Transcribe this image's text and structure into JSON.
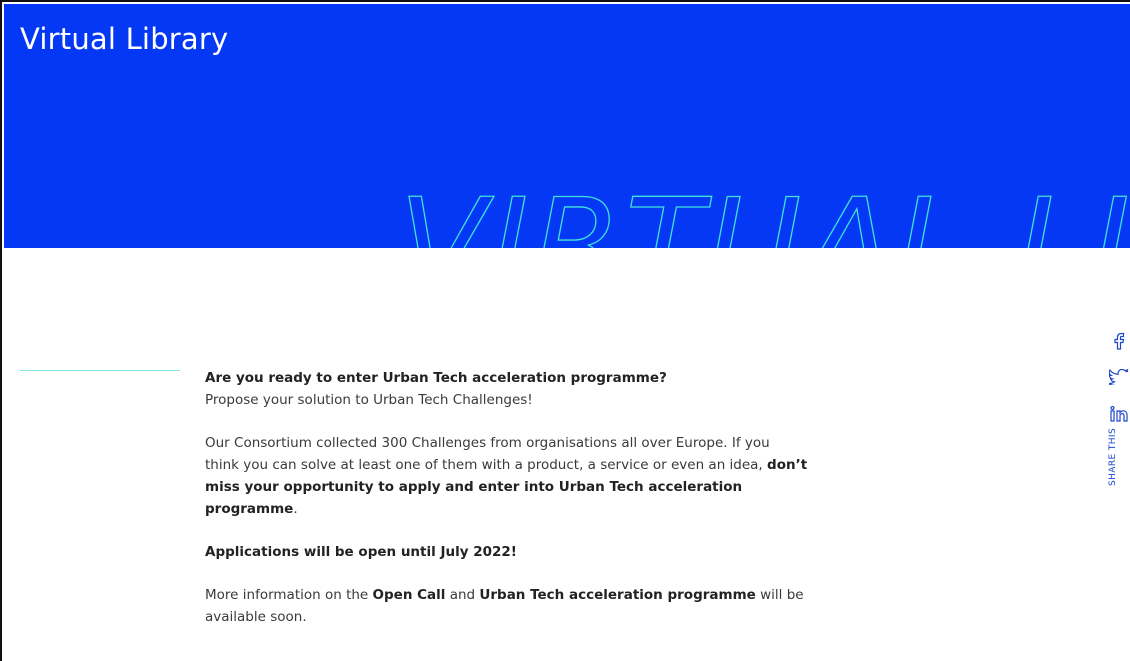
{
  "hero": {
    "title": "Virtual Library",
    "outline_text": "VIRTUAL LIBR",
    "background": "#0538f5",
    "outline_color": "#3ee3d9"
  },
  "content": {
    "heading": "Are you ready to enter Urban Tech acceleration programme?",
    "subheading": "Propose your solution to Urban Tech Challenges!",
    "para1_line1": "Our Consortium collected 300 Challenges from organisations all over Europe. If you",
    "para1_line2_plain": "think you can solve at least one of them with a product, a service or even an idea, ",
    "para1_line2_bold": "don’t",
    "para1_line3_bold": "miss your opportunity to apply and enter into Urban Tech acceleration programme",
    "para1_line3_end": ".",
    "applications": "Applications will be open until July 2022!",
    "more_prefix": "More information on the ",
    "more_open_call": "Open Call",
    "more_and": " and ",
    "more_programme": "Urban Tech acceleration programme",
    "more_suffix_line1": " will be",
    "more_line2": "available soon."
  },
  "share": {
    "label": "SHARE THIS",
    "icons": [
      "facebook-icon",
      "twitter-icon",
      "linkedin-icon"
    ],
    "color": "#1c47c9"
  }
}
